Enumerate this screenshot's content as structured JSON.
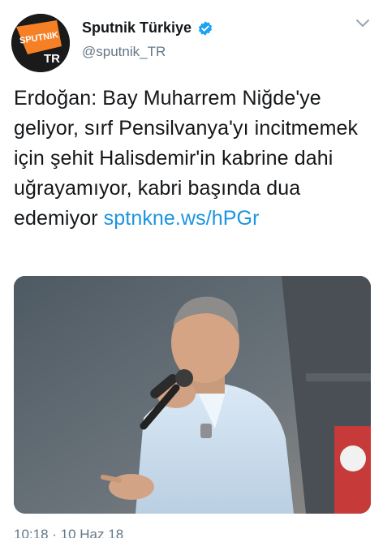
{
  "account": {
    "display_name": "Sputnik Türkiye",
    "handle": "@sputnik_TR",
    "verified": true,
    "avatar_logo_text": "SPUTNIK",
    "avatar_sub_text": "TR"
  },
  "tweet": {
    "text": "Erdoğan: Bay Muharrem Niğde'ye geliyor, sırf Pensilvanya'yı incitmemek için şehit Halisdemir'in kabrine dahi uğrayamıyor, kabri başında dua edemiyor",
    "link_text": "sptnkne.ws/hPGr",
    "timestamp": "10:18 · 10 Haz 18"
  },
  "icons": {
    "verified": "verified-badge-icon",
    "menu": "chevron-down-icon"
  },
  "colors": {
    "link": "#1b95e0",
    "verified": "#1da1f2",
    "brand_orange": "#f58025",
    "secondary_text": "#657786"
  }
}
